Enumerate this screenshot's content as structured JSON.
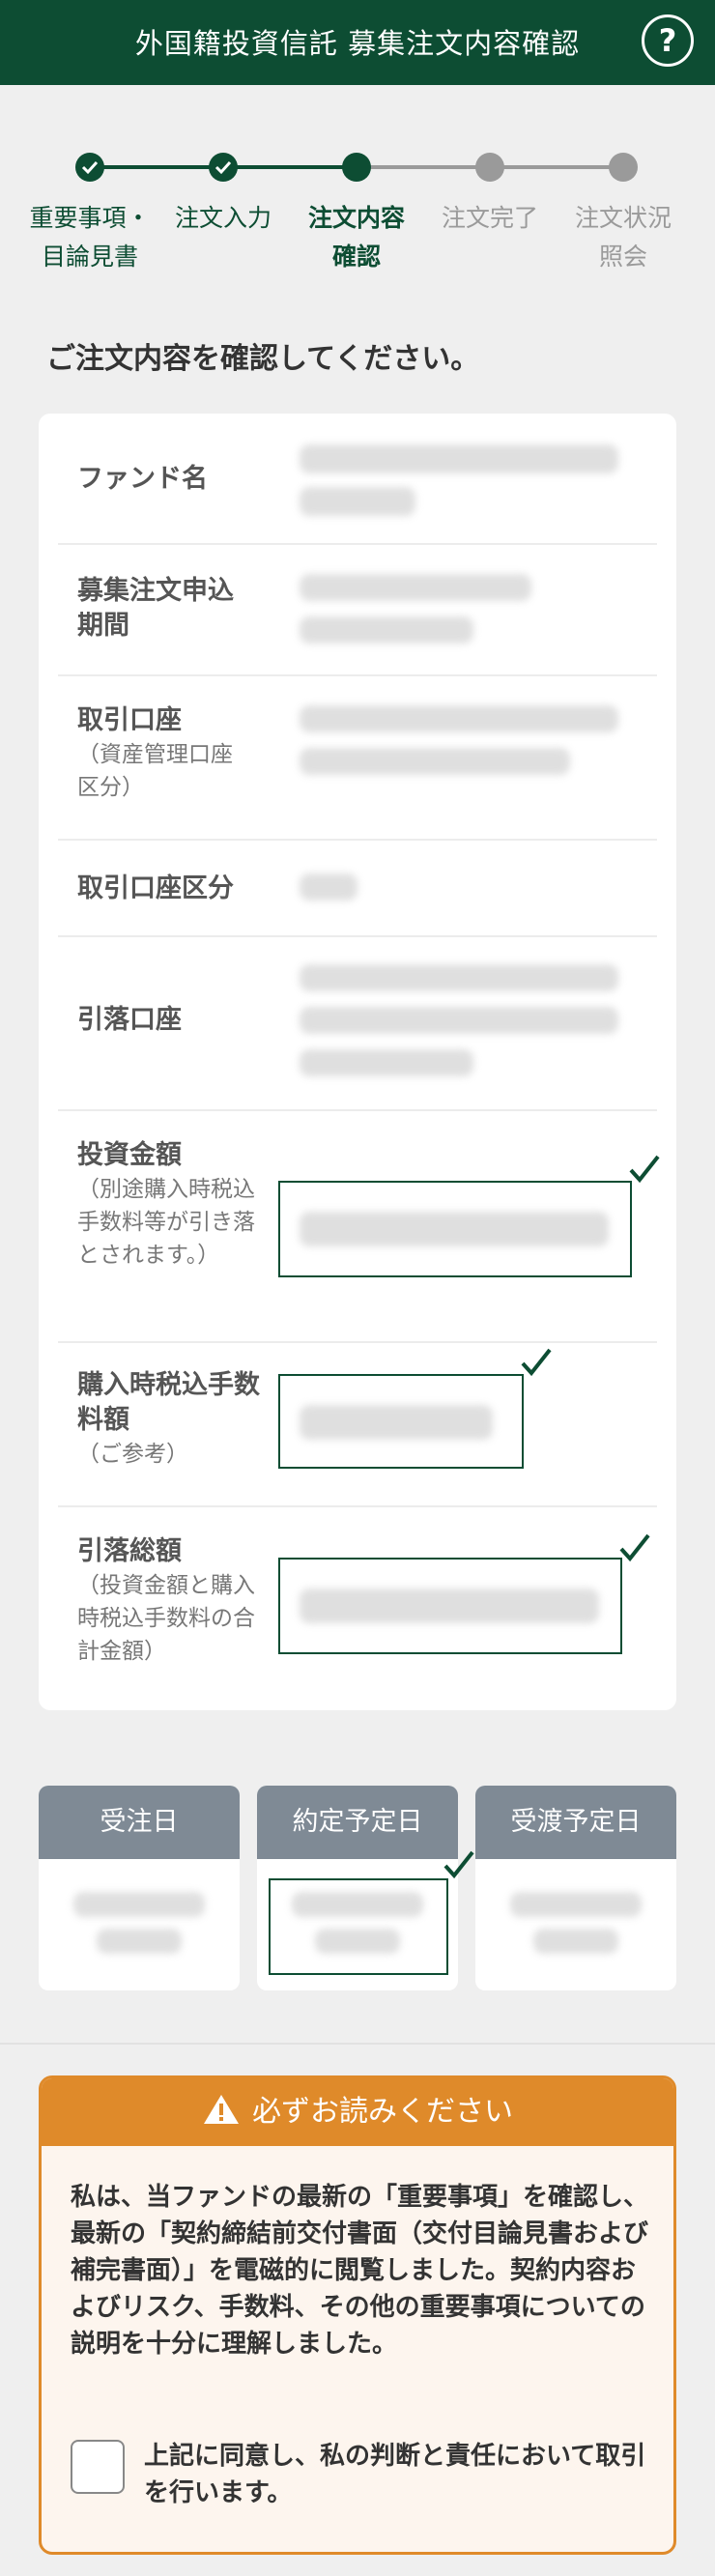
{
  "header": {
    "title": "外国籍投資信託 募集注文内容確認",
    "help_label": "?"
  },
  "stepper": {
    "steps": [
      {
        "label": "重要事項・\n目論見書",
        "status": "done"
      },
      {
        "label": "注文入力",
        "status": "done"
      },
      {
        "label": "注文内容\n確認",
        "status": "current"
      },
      {
        "label": "注文完了",
        "status": "todo"
      },
      {
        "label": "注文状況\n照会",
        "status": "todo"
      }
    ]
  },
  "confirm_heading": "ご注文内容を確認してください。",
  "order": {
    "fund_name": "ファンド名",
    "application_period": "募集注文申込\n期間",
    "account": "取引口座",
    "account_note": "（資産管理口座区分）",
    "account_type": "取引口座区分",
    "debit_account": "引落口座",
    "investment_amount": "投資金額",
    "investment_amount_note": "（別途購入時税込手数料等が引き落とされます。）",
    "purchase_fee": "購入時税込手数料額",
    "purchase_fee_note": "（ご参考）",
    "total_debit": "引落総額",
    "total_debit_note": "（投資金額と購入時税込手数料の合計金額）"
  },
  "dates": {
    "order_date": "受注日",
    "contract_date": "約定予定日",
    "delivery_date": "受渡予定日"
  },
  "notice": {
    "title": "必ずお読みください",
    "body": "私は、当ファンドの最新の「重要事項」を確認し、最新の「契約締結前交付書面（交付目論見書および補完書面）」を電磁的に閲覧しました。契約内容およびリスク、手数料、その他の重要事項についての説明を十分に理解しました。",
    "agree_label": "上記に同意し、私の判断と責任において取引を行います。"
  },
  "colors": {
    "brand_green": "#0d4d33",
    "step_todo": "#9a9a9a",
    "date_header": "#7f8a95",
    "notice_orange": "#df8a2a"
  }
}
